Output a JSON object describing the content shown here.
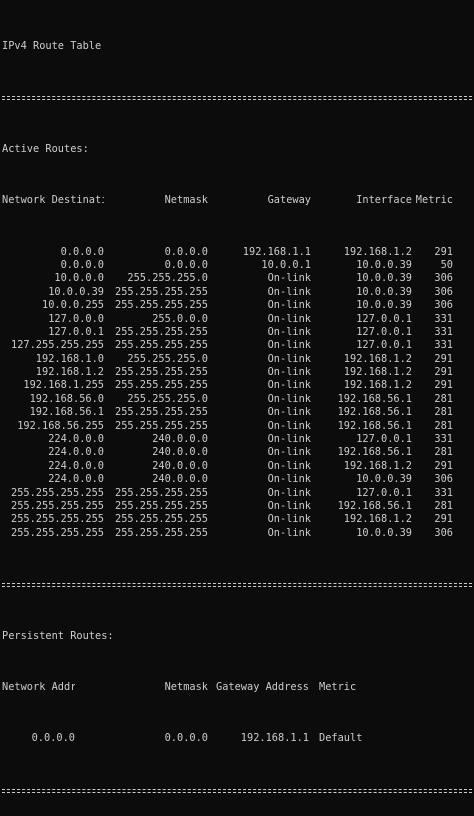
{
  "title": "IPv4 Route Table",
  "active": {
    "heading": "Active Routes:",
    "columns": {
      "destination": "Network Destination",
      "netmask": "Netmask",
      "gateway": "Gateway",
      "interface": "Interface",
      "metric": "Metric"
    },
    "rows": [
      {
        "destination": "0.0.0.0",
        "netmask": "0.0.0.0",
        "gateway": "192.168.1.1",
        "interface": "192.168.1.2",
        "metric": "291"
      },
      {
        "destination": "0.0.0.0",
        "netmask": "0.0.0.0",
        "gateway": "10.0.0.1",
        "interface": "10.0.0.39",
        "metric": "50"
      },
      {
        "destination": "10.0.0.0",
        "netmask": "255.255.255.0",
        "gateway": "On-link",
        "interface": "10.0.0.39",
        "metric": "306"
      },
      {
        "destination": "10.0.0.39",
        "netmask": "255.255.255.255",
        "gateway": "On-link",
        "interface": "10.0.0.39",
        "metric": "306"
      },
      {
        "destination": "10.0.0.255",
        "netmask": "255.255.255.255",
        "gateway": "On-link",
        "interface": "10.0.0.39",
        "metric": "306"
      },
      {
        "destination": "127.0.0.0",
        "netmask": "255.0.0.0",
        "gateway": "On-link",
        "interface": "127.0.0.1",
        "metric": "331"
      },
      {
        "destination": "127.0.0.1",
        "netmask": "255.255.255.255",
        "gateway": "On-link",
        "interface": "127.0.0.1",
        "metric": "331"
      },
      {
        "destination": "127.255.255.255",
        "netmask": "255.255.255.255",
        "gateway": "On-link",
        "interface": "127.0.0.1",
        "metric": "331"
      },
      {
        "destination": "192.168.1.0",
        "netmask": "255.255.255.0",
        "gateway": "On-link",
        "interface": "192.168.1.2",
        "metric": "291"
      },
      {
        "destination": "192.168.1.2",
        "netmask": "255.255.255.255",
        "gateway": "On-link",
        "interface": "192.168.1.2",
        "metric": "291"
      },
      {
        "destination": "192.168.1.255",
        "netmask": "255.255.255.255",
        "gateway": "On-link",
        "interface": "192.168.1.2",
        "metric": "291"
      },
      {
        "destination": "192.168.56.0",
        "netmask": "255.255.255.0",
        "gateway": "On-link",
        "interface": "192.168.56.1",
        "metric": "281"
      },
      {
        "destination": "192.168.56.1",
        "netmask": "255.255.255.255",
        "gateway": "On-link",
        "interface": "192.168.56.1",
        "metric": "281"
      },
      {
        "destination": "192.168.56.255",
        "netmask": "255.255.255.255",
        "gateway": "On-link",
        "interface": "192.168.56.1",
        "metric": "281"
      },
      {
        "destination": "224.0.0.0",
        "netmask": "240.0.0.0",
        "gateway": "On-link",
        "interface": "127.0.0.1",
        "metric": "331"
      },
      {
        "destination": "224.0.0.0",
        "netmask": "240.0.0.0",
        "gateway": "On-link",
        "interface": "192.168.56.1",
        "metric": "281"
      },
      {
        "destination": "224.0.0.0",
        "netmask": "240.0.0.0",
        "gateway": "On-link",
        "interface": "192.168.1.2",
        "metric": "291"
      },
      {
        "destination": "224.0.0.0",
        "netmask": "240.0.0.0",
        "gateway": "On-link",
        "interface": "10.0.0.39",
        "metric": "306"
      },
      {
        "destination": "255.255.255.255",
        "netmask": "255.255.255.255",
        "gateway": "On-link",
        "interface": "127.0.0.1",
        "metric": "331"
      },
      {
        "destination": "255.255.255.255",
        "netmask": "255.255.255.255",
        "gateway": "On-link",
        "interface": "192.168.56.1",
        "metric": "281"
      },
      {
        "destination": "255.255.255.255",
        "netmask": "255.255.255.255",
        "gateway": "On-link",
        "interface": "192.168.1.2",
        "metric": "291"
      },
      {
        "destination": "255.255.255.255",
        "netmask": "255.255.255.255",
        "gateway": "On-link",
        "interface": "10.0.0.39",
        "metric": "306"
      }
    ]
  },
  "persistent": {
    "heading": "Persistent Routes:",
    "columns": {
      "address": "Network Address",
      "netmask": "Netmask",
      "gateway": "Gateway Address",
      "metric": "Metric"
    },
    "rows": [
      {
        "address": "0.0.0.0",
        "netmask": "0.0.0.0",
        "gateway": "192.168.1.1",
        "metric": "Default"
      }
    ]
  },
  "colors": {
    "background": "#0c0c0c",
    "text": "#cccccc"
  }
}
